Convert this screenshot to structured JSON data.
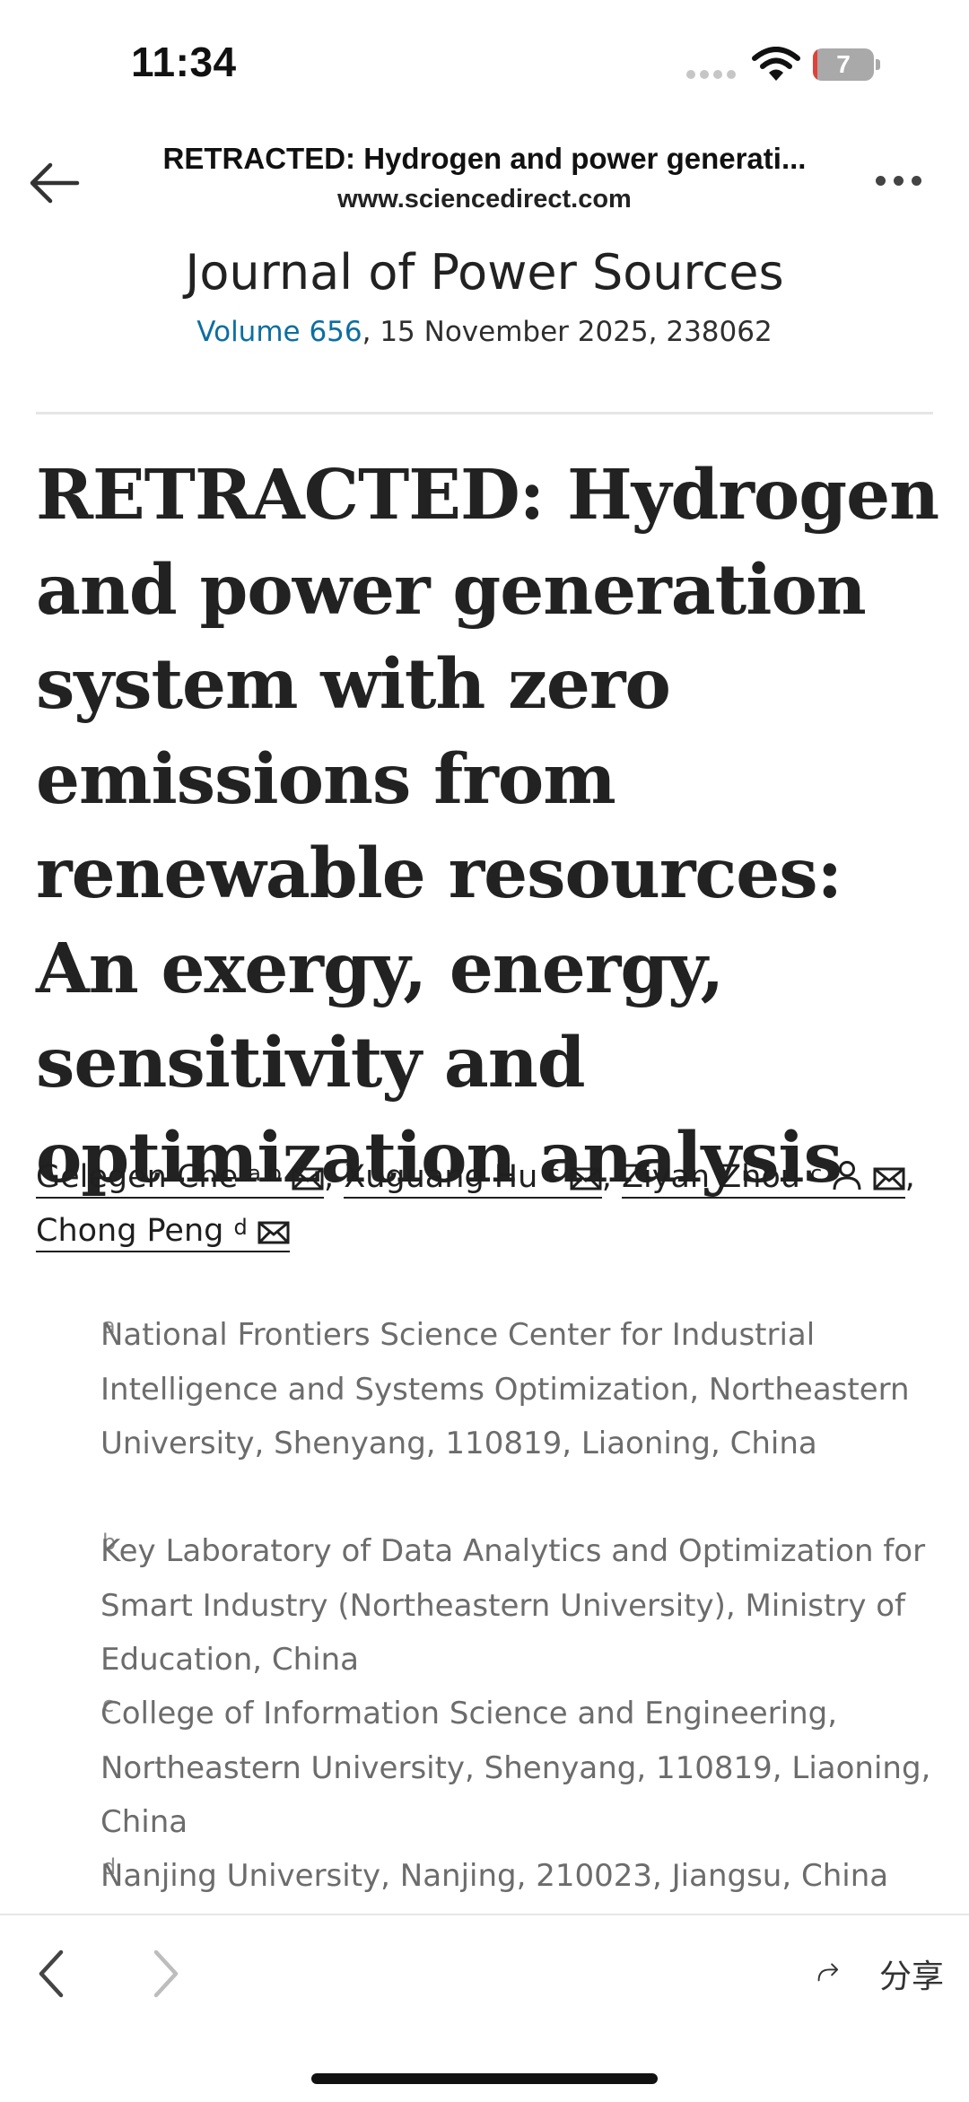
{
  "status_bar": {
    "time": "11:34",
    "battery_level": "7",
    "battery_fraction": 0.07,
    "accent_low_battery": "#e2403a"
  },
  "nav": {
    "title": "RETRACTED: Hydrogen and power generati...",
    "url": "www.sciencedirect.com",
    "back_icon": "arrow-left-icon",
    "more_icon": "more-horizontal-icon"
  },
  "journal": {
    "name": "Journal of Power Sources",
    "volume_link": "Volume 656",
    "date_and_id": ", 15 November 2025, 238062",
    "link_color": "#0c6ea1"
  },
  "article": {
    "title": "RETRACTED: Hydrogen and power generation system with zero emissions from renewable resources: An exergy, energy, sensitivity and optimization analysis"
  },
  "authors": [
    {
      "name": "Gelegen Che",
      "sup": "a b"
    },
    {
      "name": "Xuguang Hu",
      "sup": "c"
    },
    {
      "name": "Ziyan Zhou",
      "sup": "c"
    },
    {
      "name": "Chong Peng",
      "sup": "d"
    }
  ],
  "affiliations": [
    {
      "label": "a",
      "text": "National Frontiers Science Center for Industrial Intelligence and Systems Optimization, Northeastern University, Shenyang, 110819, Liaoning, China"
    },
    {
      "label": "b",
      "text": "Key Laboratory of Data Analytics and Optimization for Smart Industry (Northeastern University), Ministry of Education, China"
    },
    {
      "label": "c",
      "text": "College of Information Science and Engineering, Northeastern University, Shenyang, 110819, Liaoning, China"
    },
    {
      "label": "d",
      "text": "Nanjing University, Nanjing, 210023, Jiangsu, China"
    }
  ],
  "toolbar": {
    "share_label": "分享",
    "prev_icon": "chevron-left-icon",
    "next_icon": "chevron-right-icon",
    "share_icon": "share-arrow-icon"
  }
}
